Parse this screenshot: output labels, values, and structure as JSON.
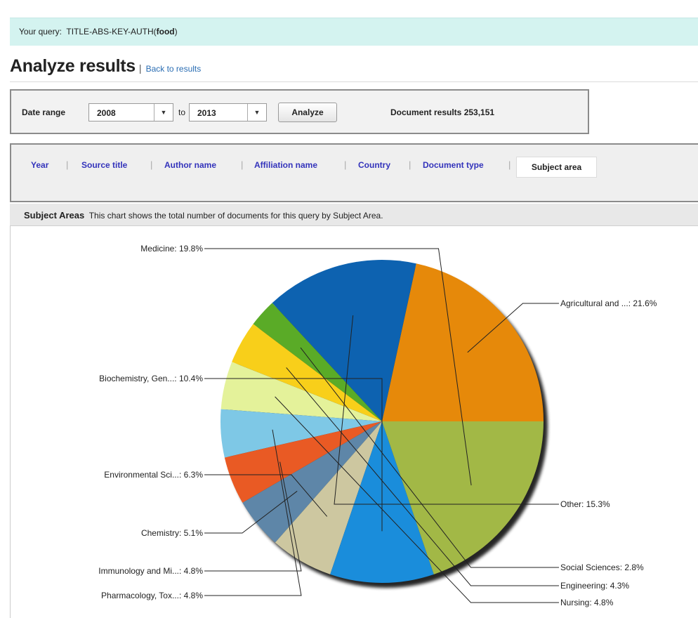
{
  "query": {
    "prefix": "Your query:",
    "text": "TITLE-ABS-KEY-AUTH(",
    "term": "food",
    "suffix": ")"
  },
  "header": {
    "title": "Analyze results",
    "separator": "|",
    "back_link": "Back to results"
  },
  "date_range": {
    "label": "Date range",
    "from": "2008",
    "to_label": "to",
    "to": "2013",
    "analyze_label": "Analyze",
    "results_text": "Document results 253,151"
  },
  "tabs": [
    {
      "label": "Year"
    },
    {
      "label": "Source title"
    },
    {
      "label": "Author name"
    },
    {
      "label": "Affiliation name"
    },
    {
      "label": "Country"
    },
    {
      "label": "Document type"
    },
    {
      "label": "Subject area"
    }
  ],
  "subject_areas": {
    "title": "Subject Areas",
    "description": "This chart shows the total number of documents for this query by Subject Area."
  },
  "chart_data": {
    "type": "pie",
    "slices": [
      {
        "label": "Agricultural and ...: 21.6%",
        "value": 21.6,
        "color": "#e6890a"
      },
      {
        "label": "Other: 15.3%",
        "value": 15.3,
        "color": "#0d62b0"
      },
      {
        "label": "Social Sciences: 2.8%",
        "value": 2.8,
        "color": "#5aab27"
      },
      {
        "label": "Engineering: 4.3%",
        "value": 4.3,
        "color": "#f8cf1a"
      },
      {
        "label": "Nursing: 4.8%",
        "value": 4.8,
        "color": "#e4f29a"
      },
      {
        "label": "Pharmacology, Tox...: 4.8%",
        "value": 4.8,
        "color": "#7ec8e6"
      },
      {
        "label": "Immunology and Mi...: 4.8%",
        "value": 4.8,
        "color": "#e95a24"
      },
      {
        "label": "Chemistry: 5.1%",
        "value": 5.1,
        "color": "#5e86a8"
      },
      {
        "label": "Environmental Sci...: 6.3%",
        "value": 6.3,
        "color": "#cdc7a0"
      },
      {
        "label": "Biochemistry, Gen...: 10.4%",
        "value": 10.4,
        "color": "#1a8ddb"
      },
      {
        "label": "Medicine: 19.8%",
        "value": 19.8,
        "color": "#a2b846"
      }
    ]
  }
}
